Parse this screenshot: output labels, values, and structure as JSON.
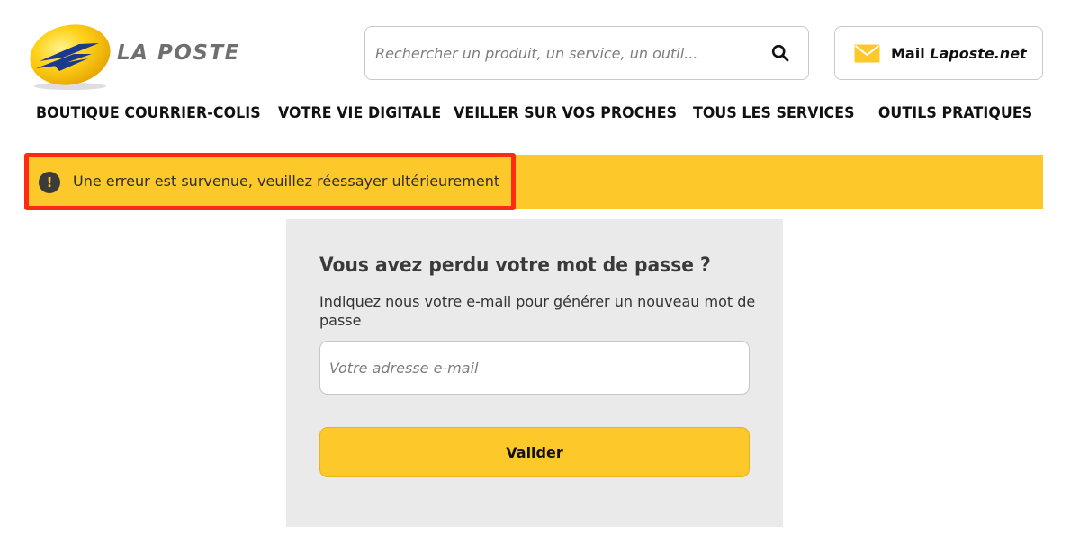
{
  "header": {
    "logo_text": "LA POSTE",
    "search": {
      "placeholder": "Rechercher un produit, un service, un outil...",
      "value": ""
    },
    "mail_button": {
      "label_prefix": "Mail",
      "label_brand": "Laposte.net"
    }
  },
  "nav": {
    "items": [
      {
        "label": "BOUTIQUE COURRIER-COLIS"
      },
      {
        "label": "VOTRE VIE DIGITALE"
      },
      {
        "label": "VEILLER SUR VOS PROCHES"
      },
      {
        "label": "TOUS LES SERVICES"
      },
      {
        "label": "OUTILS PRATIQUES"
      }
    ]
  },
  "alert": {
    "icon_glyph": "!",
    "message": "Une erreur est survenue, veuillez réessayer ultérieurement"
  },
  "form": {
    "title": "Vous avez perdu votre mot de passe ?",
    "description": "Indiquez nous votre e-mail pour générer un nouveau mot de passe",
    "email_placeholder": "Votre adresse e-mail",
    "email_value": "",
    "submit_label": "Valider"
  },
  "colors": {
    "brand_yellow": "#fdc92a",
    "highlight_red": "#ff2a12",
    "logo_blue": "#1b3a8e",
    "card_bg": "#eaeaea"
  }
}
